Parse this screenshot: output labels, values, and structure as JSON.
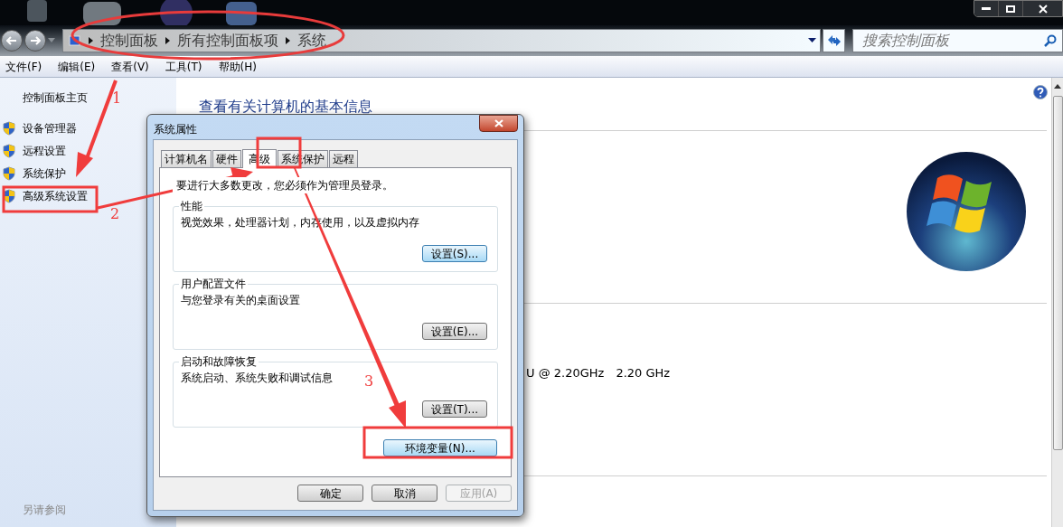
{
  "address_bar": {
    "breadcrumbs": [
      "控制面板",
      "所有控制面板项",
      "系统"
    ]
  },
  "search": {
    "placeholder": "搜索控制面板"
  },
  "menu": [
    "文件(F)",
    "编辑(E)",
    "查看(V)",
    "工具(T)",
    "帮助(H)"
  ],
  "sidebar": {
    "home": "控制面板主页",
    "items": [
      "设备管理器",
      "远程设置",
      "系统保护",
      "高级系统设置"
    ],
    "see_also": "另请参阅"
  },
  "content": {
    "heading": "查看有关计算机的基本信息",
    "processor": "U @ 2.20GHz",
    "speed": "2.20 GHz"
  },
  "dialog": {
    "title": "系统属性",
    "tabs": [
      {
        "label": "计算机名",
        "selected": false
      },
      {
        "label": "硬件",
        "selected": false
      },
      {
        "label": "高级",
        "selected": true
      },
      {
        "label": "系统保护",
        "selected": false
      },
      {
        "label": "远程",
        "selected": false
      }
    ],
    "notice": "要进行大多数更改，您必须作为管理员登录。",
    "groups": [
      {
        "title": "性能",
        "description": "视觉效果，处理器计划，内存使用，以及虚拟内存",
        "button": {
          "label": "设置(S)...",
          "highlighted": true
        }
      },
      {
        "title": "用户配置文件",
        "description": "与您登录有关的桌面设置",
        "button": {
          "label": "设置(E)...",
          "highlighted": false
        }
      },
      {
        "title": "启动和故障恢复",
        "description": "系统启动、系统失败和调试信息",
        "button": {
          "label": "设置(T)...",
          "highlighted": false
        }
      }
    ],
    "env_button": {
      "label": "环境变量(N)...",
      "highlighted": true
    },
    "footer_buttons": [
      {
        "label": "确定",
        "disabled": false
      },
      {
        "label": "取消",
        "disabled": false
      },
      {
        "label": "应用(A)",
        "disabled": true
      }
    ]
  },
  "step_labels": [
    "1",
    "2",
    "3"
  ]
}
